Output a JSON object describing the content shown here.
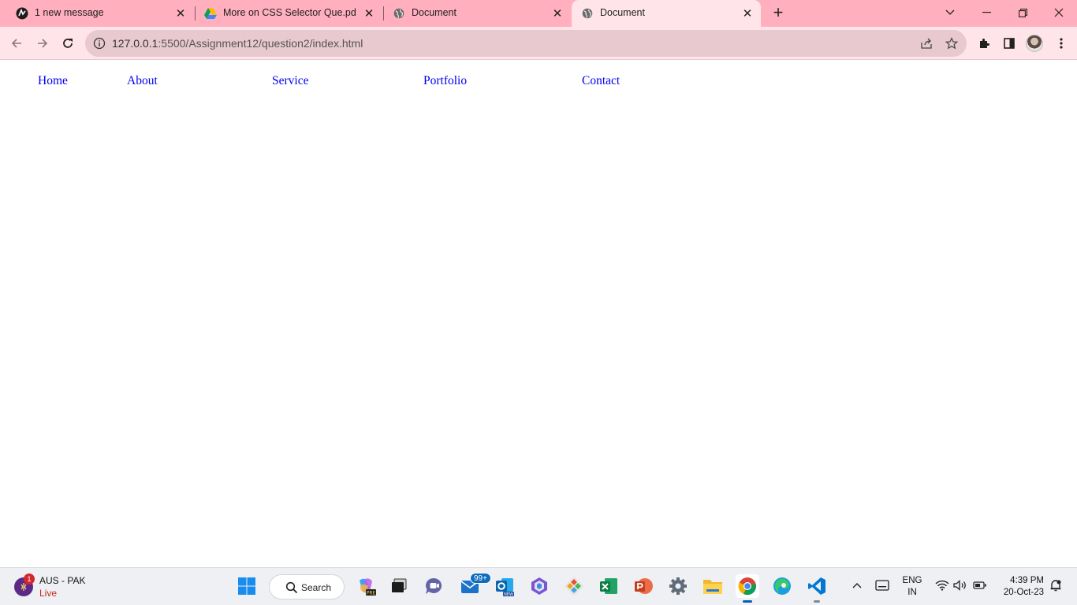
{
  "browser": {
    "tabs": [
      {
        "title": "1 new message",
        "favicon": "chat-app-icon",
        "active": false
      },
      {
        "title": "More on CSS Selector Que.pdf -",
        "favicon": "google-drive-icon",
        "active": false
      },
      {
        "title": "Document",
        "favicon": "globe-icon",
        "active": false
      },
      {
        "title": "Document",
        "favicon": "globe-icon",
        "active": true
      }
    ],
    "url_host": "127.0.0.1",
    "url_rest": ":5500/Assignment12/question2/index.html",
    "colors": {
      "tabstrip": "#ffafbd",
      "toolbar": "#ffe5ea",
      "omnibox": "#e8c9cf"
    }
  },
  "page": {
    "nav": [
      {
        "label": "Home"
      },
      {
        "label": "About"
      },
      {
        "label": "Service"
      },
      {
        "label": "Portfolio"
      },
      {
        "label": "Contact"
      }
    ],
    "link_color": "#0000ee"
  },
  "taskbar": {
    "weather": {
      "title": "AUS - PAK",
      "subtitle": "Live",
      "badge": "1"
    },
    "search_label": "Search",
    "mail_badge": "99+",
    "language": {
      "line1": "ENG",
      "line2": "IN"
    },
    "clock": {
      "time": "4:39 PM",
      "date": "20-Oct-23"
    },
    "apps": [
      "windows-start",
      "search",
      "copilot-pre",
      "task-view",
      "teams-chat",
      "mail",
      "outlook-new",
      "app-hex",
      "gitkraken",
      "excel",
      "powerpoint",
      "settings",
      "file-explorer",
      "chrome",
      "edge",
      "vscode"
    ]
  }
}
